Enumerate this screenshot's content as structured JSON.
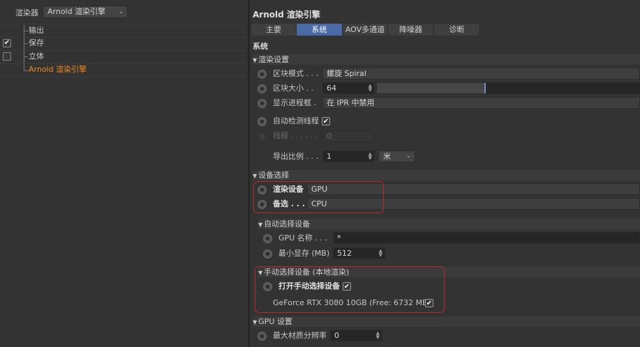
{
  "left": {
    "renderer_label": "渲染器",
    "renderer_value": "Arnold 渲染引擎",
    "tree": [
      {
        "label": "输出",
        "checked": false,
        "has_check": false,
        "active": false
      },
      {
        "label": "保存",
        "checked": true,
        "has_check": true,
        "active": false
      },
      {
        "label": "立体",
        "checked": false,
        "has_check": true,
        "active": false
      },
      {
        "label": "Arnold 渲染引擎",
        "checked": false,
        "has_check": false,
        "active": true
      }
    ]
  },
  "right": {
    "title": "Arnold 渲染引擎",
    "tabs": [
      "主要",
      "系统",
      "AOV多通道",
      "降噪器",
      "诊断"
    ],
    "active_tab": "系统",
    "section_heading": "系统",
    "render_settings": {
      "heading": "渲染设置",
      "bucket_mode_label": "区块模式 . . .",
      "bucket_mode_value": "螺旋 Spiral",
      "bucket_size_label": "区块大小 . .",
      "bucket_size_value": "64",
      "bucket_size_fraction": 0.41,
      "progress_label": "显示进程框 .",
      "progress_value": "在 IPR 中禁用",
      "auto_threads_label": "自动检测线程",
      "auto_threads_checked": true,
      "threads_label": "线程 . . . . . .",
      "threads_value": "0",
      "export_scale_label": "导出比例 . . .",
      "export_scale_value": "1",
      "export_scale_unit": "米"
    },
    "device_selection": {
      "heading": "设备选择",
      "render_device_label": "渲染设备",
      "render_device_value": "GPU",
      "fallback_label": "备选 . . .",
      "fallback_value": "CPU"
    },
    "auto_device": {
      "heading": "自动选择设备",
      "gpu_name_label": "GPU 名称 . . .",
      "gpu_name_value": "*",
      "min_memory_label": "最小显存 (MB)",
      "min_memory_value": "512"
    },
    "manual_device": {
      "heading": "手动选择设备 (本地渲染)",
      "enable_label": "打开手动选择设备",
      "enable_checked": true,
      "gpu_entry_label": "GeForce RTX 3080 10GB (Free: 6732 MB)",
      "gpu_entry_checked": true
    },
    "gpu_settings": {
      "heading": "GPU 设置",
      "max_resolution_label": "最大材质分辨率",
      "max_resolution_value": "0"
    }
  },
  "icons": {
    "checkmark": "✔",
    "chevron_down": "⌄",
    "triangle_down": "▼",
    "spinner": "▲▼"
  }
}
